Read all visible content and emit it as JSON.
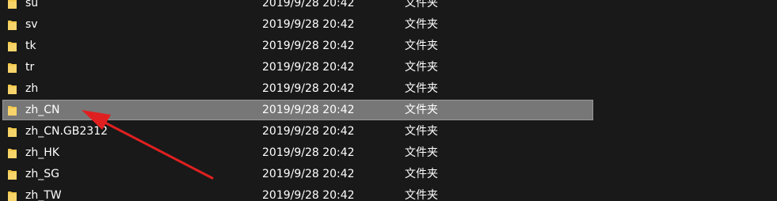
{
  "folders": [
    {
      "name": "su",
      "modified": "2019/9/28 20:42",
      "type": "文件夹"
    },
    {
      "name": "sv",
      "modified": "2019/9/28 20:42",
      "type": "文件夹"
    },
    {
      "name": "tk",
      "modified": "2019/9/28 20:42",
      "type": "文件夹"
    },
    {
      "name": "tr",
      "modified": "2019/9/28 20:42",
      "type": "文件夹"
    },
    {
      "name": "zh",
      "modified": "2019/9/28 20:42",
      "type": "文件夹"
    },
    {
      "name": "zh_CN",
      "modified": "2019/9/28 20:42",
      "type": "文件夹",
      "selected": true
    },
    {
      "name": "zh_CN.GB2312",
      "modified": "2019/9/28 20:42",
      "type": "文件夹"
    },
    {
      "name": "zh_HK",
      "modified": "2019/9/28 20:42",
      "type": "文件夹"
    },
    {
      "name": "zh_SG",
      "modified": "2019/9/28 20:42",
      "type": "文件夹"
    },
    {
      "name": "zh_TW",
      "modified": "2019/9/28 20:42",
      "type": "文件夹"
    }
  ],
  "annotation": {
    "color": "#e02020",
    "points_to": "zh_CN"
  },
  "colors": {
    "background": "#191919",
    "selection": "#777777",
    "folder": "#f2c94c"
  }
}
